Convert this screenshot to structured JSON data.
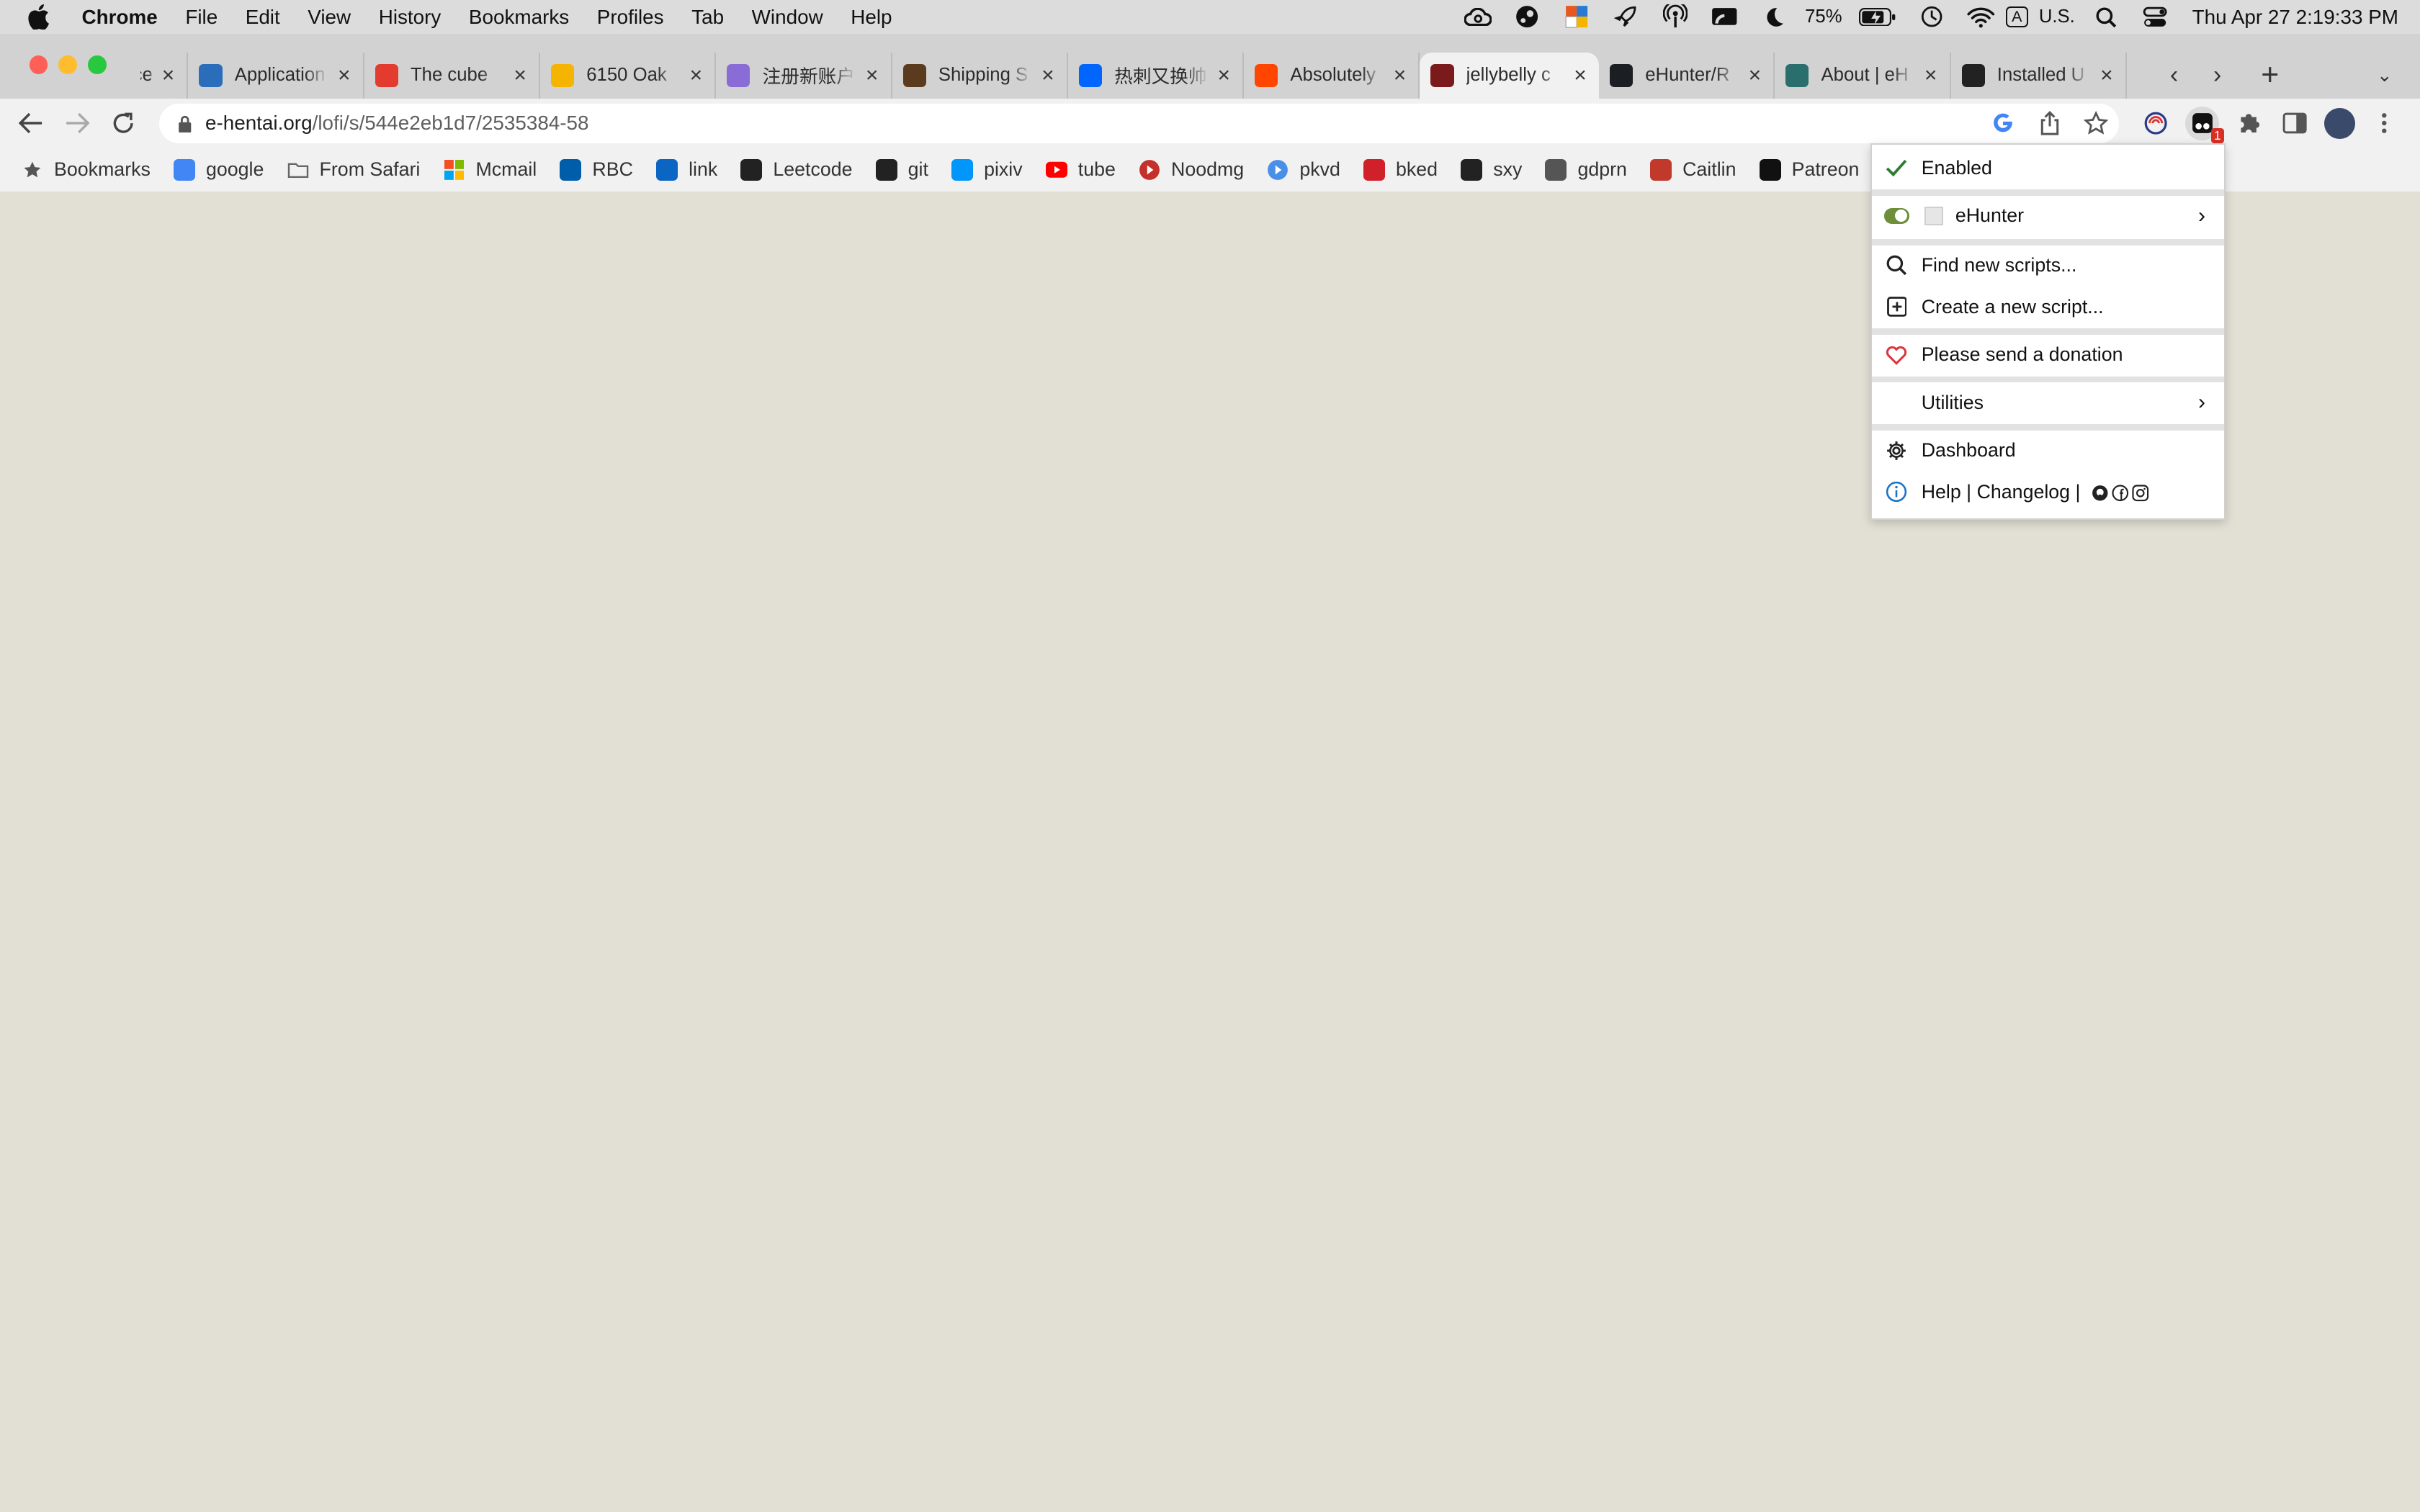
{
  "menubar": {
    "app": "Chrome",
    "items": [
      "File",
      "Edit",
      "View",
      "History",
      "Bookmarks",
      "Profiles",
      "Tab",
      "Window",
      "Help"
    ],
    "status_icons": [
      "creative-cloud-icon",
      "steam-icon",
      "office-icon",
      "rocket-icon",
      "airdrop-icon",
      "cast-icon",
      "moon-icon"
    ],
    "battery": "75%",
    "input_source_badge": "A",
    "input_source": "U.S.",
    "clock": "Thu Apr 27  2:19:33 PM"
  },
  "tabs": [
    {
      "title": "Insurance",
      "color": "#ffffff"
    },
    {
      "title": "Application",
      "color": "#2a6ebb"
    },
    {
      "title": "The cube",
      "color": "#e33b2e"
    },
    {
      "title": "6150 Oak",
      "color": "#f4b400"
    },
    {
      "title": "注册新账户",
      "color": "#8a6cd6"
    },
    {
      "title": "Shipping S",
      "color": "#5a3b1e"
    },
    {
      "title": "热刺又换帅",
      "color": "#0066ff"
    },
    {
      "title": "Absolutely",
      "color": "#ff4500"
    },
    {
      "title": "jellybelly c",
      "color": "#7a1a1a",
      "active": true
    },
    {
      "title": "eHunter/R",
      "color": "#1b1f23"
    },
    {
      "title": "About | eH",
      "color": "#2a6e6e"
    },
    {
      "title": "Installed U",
      "color": "#222222"
    }
  ],
  "toolbar": {
    "url_host": "e-hentai.org",
    "url_path": "/lofi/s/544e2eb1d7/2535384-58",
    "extension_badge": "1"
  },
  "bookmarks": [
    {
      "label": "Bookmarks",
      "icon": "star-icon"
    },
    {
      "label": "google",
      "icon": "google-icon"
    },
    {
      "label": "From Safari",
      "icon": "folder-icon"
    },
    {
      "label": "Mcmail",
      "icon": "microsoft-icon"
    },
    {
      "label": "RBC",
      "icon": "rbc-icon"
    },
    {
      "label": "link",
      "icon": "linkedin-icon"
    },
    {
      "label": "Leetcode",
      "icon": "leetcode-icon"
    },
    {
      "label": "git",
      "icon": "github-icon"
    },
    {
      "label": "pixiv",
      "icon": "pixiv-icon"
    },
    {
      "label": "tube",
      "icon": "youtube-icon"
    },
    {
      "label": "Noodmg",
      "icon": "play-icon"
    },
    {
      "label": "pkvd",
      "icon": "play-circle-icon"
    },
    {
      "label": "bked",
      "icon": "bked-icon"
    },
    {
      "label": "sxy",
      "icon": "sxy-icon"
    },
    {
      "label": "gdprn",
      "icon": "gp-icon"
    },
    {
      "label": "Caitlin",
      "icon": "caitlin-icon"
    },
    {
      "label": "Patreon",
      "icon": "patreon-icon"
    }
  ],
  "popup": {
    "enabled": "Enabled",
    "script_name": "eHunter",
    "find_scripts": "Find new scripts...",
    "create_script": "Create a new script...",
    "donation": "Please send a donation",
    "utilities": "Utilities",
    "dashboard": "Dashboard",
    "help": "Help | Changelog | "
  }
}
